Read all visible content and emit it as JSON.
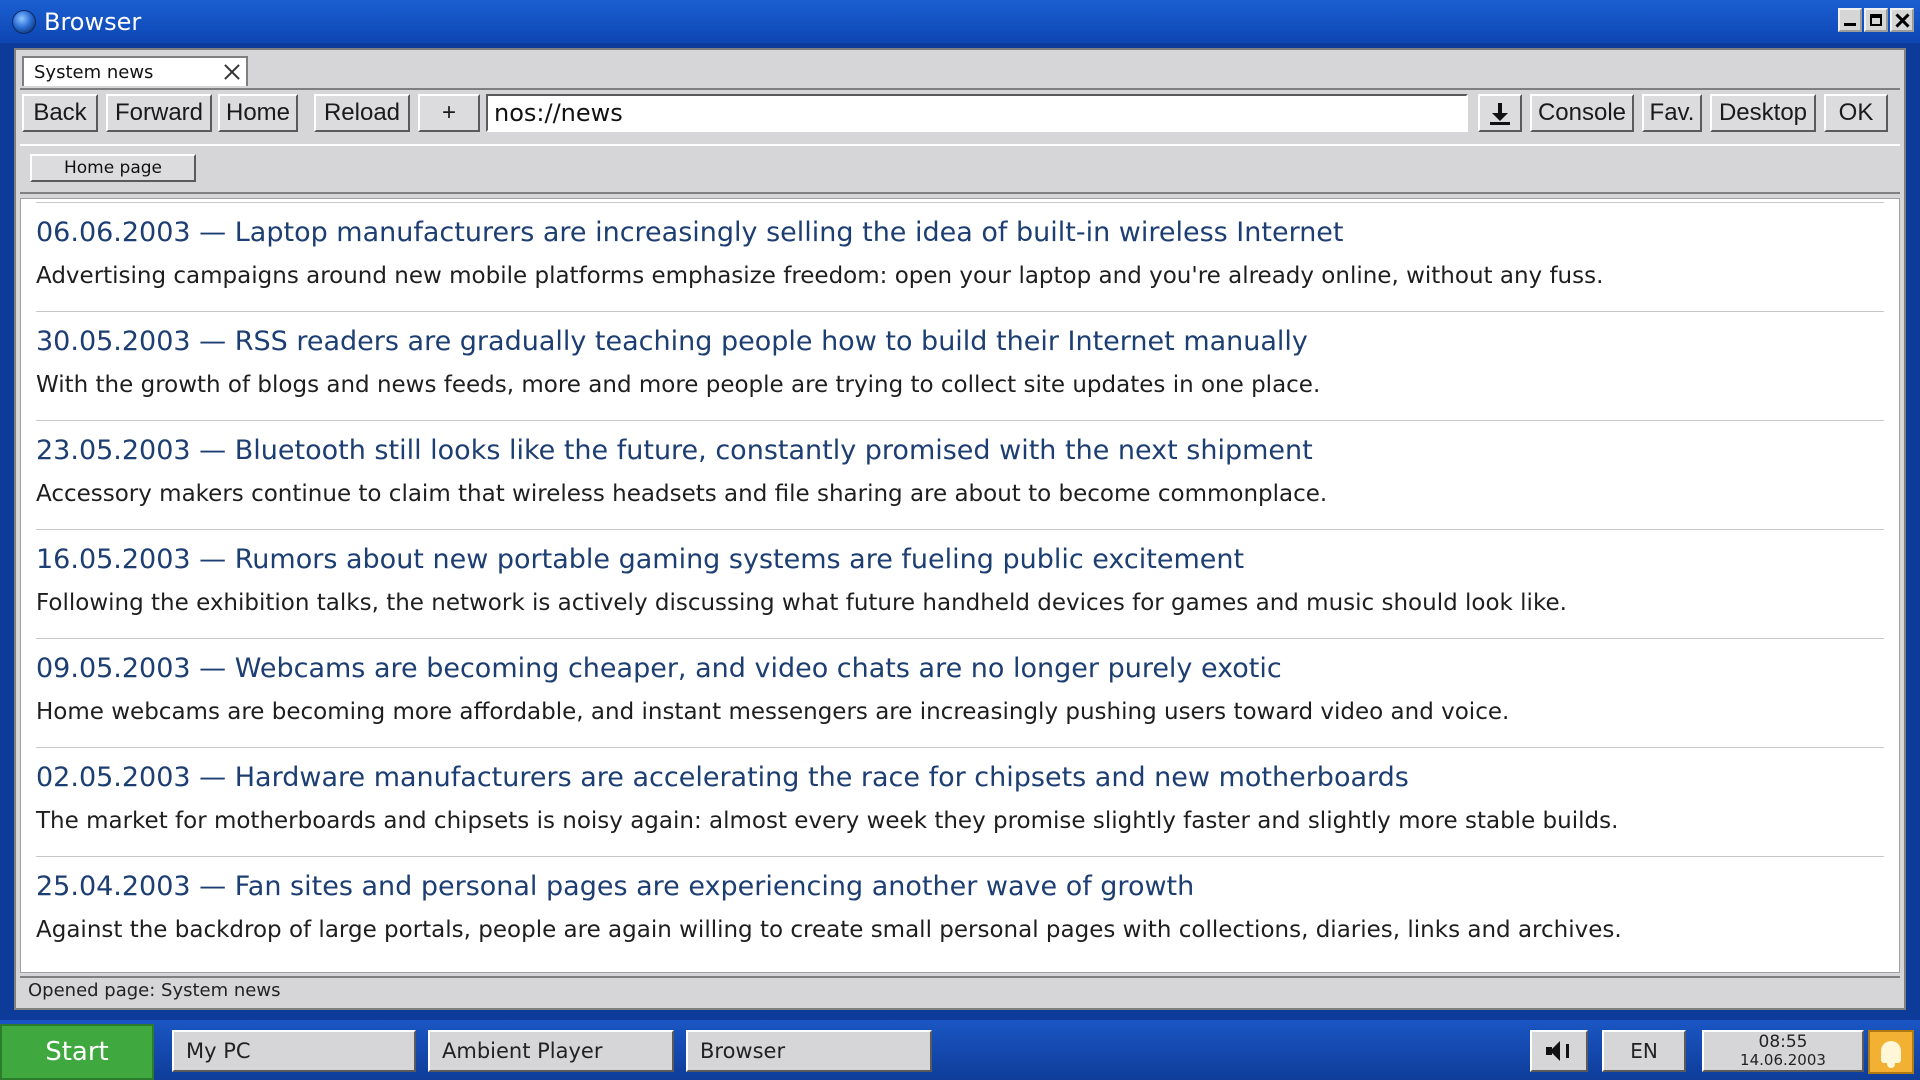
{
  "window": {
    "title": "Browser"
  },
  "tab": {
    "label": "System news"
  },
  "toolbar": {
    "back": "Back",
    "forward": "Forward",
    "home": "Home",
    "reload": "Reload",
    "new_tab": "+",
    "url": "nos://news",
    "download_icon": "download-icon",
    "console": "Console",
    "fav": "Fav.",
    "desktop": "Desktop",
    "ok": "OK"
  },
  "bookmarks": {
    "home_page": "Home page"
  },
  "articles": [
    {
      "headline": "06.06.2003 — Laptop manufacturers are increasingly selling the idea of built-in wireless Internet",
      "summary": "Advertising campaigns around new mobile platforms emphasize freedom: open your laptop and you're already online, without any fuss."
    },
    {
      "headline": "30.05.2003 — RSS readers are gradually teaching people how to build their Internet manually",
      "summary": "With the growth of blogs and news feeds, more and more people are trying to collect site updates in one place."
    },
    {
      "headline": "23.05.2003 — Bluetooth still looks like the future, constantly promised with the next shipment",
      "summary": "Accessory makers continue to claim that wireless headsets and file sharing are about to become commonplace."
    },
    {
      "headline": "16.05.2003 — Rumors about new portable gaming systems are fueling public excitement",
      "summary": "Following the exhibition talks, the network is actively discussing what future handheld devices for games and music should look like."
    },
    {
      "headline": "09.05.2003 — Webcams are becoming cheaper, and video chats are no longer purely exotic",
      "summary": "Home webcams are becoming more affordable, and instant messengers are increasingly pushing users toward video and voice."
    },
    {
      "headline": "02.05.2003 — Hardware manufacturers are accelerating the race for chipsets and new motherboards",
      "summary": "The market for motherboards and chipsets is noisy again: almost every week they promise slightly faster and slightly more stable builds."
    },
    {
      "headline": "25.04.2003 — Fan sites and personal pages are experiencing another wave of growth",
      "summary": "Against the backdrop of large portals, people are again willing to create small personal pages with collections, diaries, links and archives."
    }
  ],
  "status": {
    "text": "Opened page: System news"
  },
  "taskbar": {
    "start": "Start",
    "tasks": [
      "My PC",
      "Ambient Player",
      "Browser"
    ],
    "language": "EN",
    "time": "08:55",
    "date": "14.06.2003"
  }
}
